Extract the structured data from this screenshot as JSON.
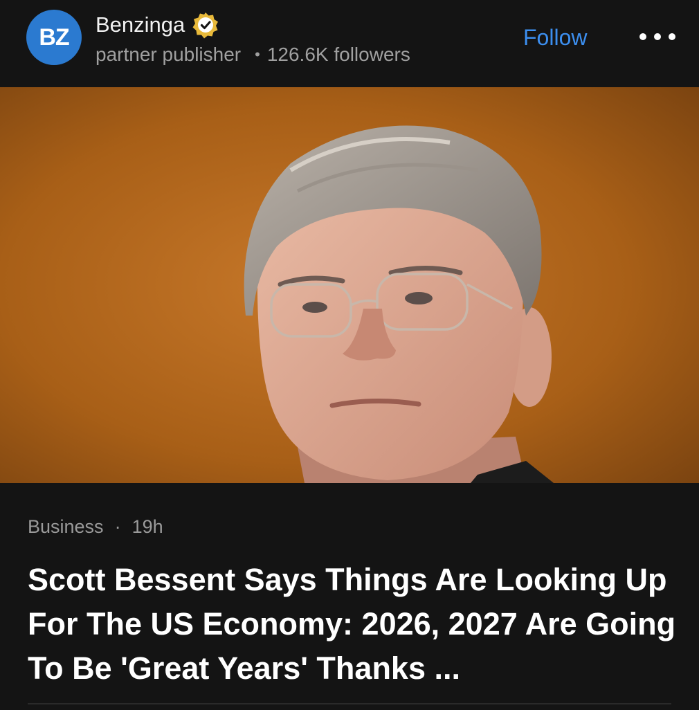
{
  "publisher": {
    "logo_text": "BZ",
    "name": "Benzinga",
    "role": "partner publisher",
    "followers": "126.6K followers",
    "follow_label": "Follow",
    "verified_badge_icon": "verified-badge-icon"
  },
  "article": {
    "category": "Business",
    "separator": "·",
    "age": "19h",
    "title": "Scott Bessent Says Things Are Looking Up For The US Economy: 2026, 2027 Are Going To Be 'Great Years' Thanks ...",
    "image_subject": "man-portrait-photo"
  },
  "colors": {
    "background": "#141414",
    "accent_link": "#3c8ff0",
    "logo_blue": "#2b7ad0",
    "badge_gold": "#e8b93a",
    "hero_background": "#b3681c"
  }
}
